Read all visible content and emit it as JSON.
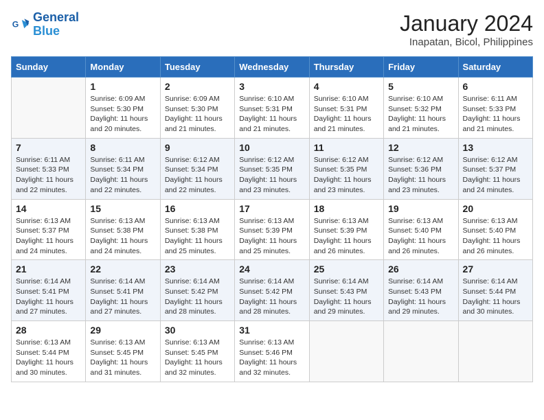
{
  "logo": {
    "line1": "General",
    "line2": "Blue"
  },
  "title": "January 2024",
  "subtitle": "Inapatan, Bicol, Philippines",
  "headers": [
    "Sunday",
    "Monday",
    "Tuesday",
    "Wednesday",
    "Thursday",
    "Friday",
    "Saturday"
  ],
  "weeks": [
    [
      {
        "num": "",
        "info": ""
      },
      {
        "num": "1",
        "info": "Sunrise: 6:09 AM\nSunset: 5:30 PM\nDaylight: 11 hours\nand 20 minutes."
      },
      {
        "num": "2",
        "info": "Sunrise: 6:09 AM\nSunset: 5:30 PM\nDaylight: 11 hours\nand 21 minutes."
      },
      {
        "num": "3",
        "info": "Sunrise: 6:10 AM\nSunset: 5:31 PM\nDaylight: 11 hours\nand 21 minutes."
      },
      {
        "num": "4",
        "info": "Sunrise: 6:10 AM\nSunset: 5:31 PM\nDaylight: 11 hours\nand 21 minutes."
      },
      {
        "num": "5",
        "info": "Sunrise: 6:10 AM\nSunset: 5:32 PM\nDaylight: 11 hours\nand 21 minutes."
      },
      {
        "num": "6",
        "info": "Sunrise: 6:11 AM\nSunset: 5:33 PM\nDaylight: 11 hours\nand 21 minutes."
      }
    ],
    [
      {
        "num": "7",
        "info": "Sunrise: 6:11 AM\nSunset: 5:33 PM\nDaylight: 11 hours\nand 22 minutes."
      },
      {
        "num": "8",
        "info": "Sunrise: 6:11 AM\nSunset: 5:34 PM\nDaylight: 11 hours\nand 22 minutes."
      },
      {
        "num": "9",
        "info": "Sunrise: 6:12 AM\nSunset: 5:34 PM\nDaylight: 11 hours\nand 22 minutes."
      },
      {
        "num": "10",
        "info": "Sunrise: 6:12 AM\nSunset: 5:35 PM\nDaylight: 11 hours\nand 23 minutes."
      },
      {
        "num": "11",
        "info": "Sunrise: 6:12 AM\nSunset: 5:35 PM\nDaylight: 11 hours\nand 23 minutes."
      },
      {
        "num": "12",
        "info": "Sunrise: 6:12 AM\nSunset: 5:36 PM\nDaylight: 11 hours\nand 23 minutes."
      },
      {
        "num": "13",
        "info": "Sunrise: 6:12 AM\nSunset: 5:37 PM\nDaylight: 11 hours\nand 24 minutes."
      }
    ],
    [
      {
        "num": "14",
        "info": "Sunrise: 6:13 AM\nSunset: 5:37 PM\nDaylight: 11 hours\nand 24 minutes."
      },
      {
        "num": "15",
        "info": "Sunrise: 6:13 AM\nSunset: 5:38 PM\nDaylight: 11 hours\nand 24 minutes."
      },
      {
        "num": "16",
        "info": "Sunrise: 6:13 AM\nSunset: 5:38 PM\nDaylight: 11 hours\nand 25 minutes."
      },
      {
        "num": "17",
        "info": "Sunrise: 6:13 AM\nSunset: 5:39 PM\nDaylight: 11 hours\nand 25 minutes."
      },
      {
        "num": "18",
        "info": "Sunrise: 6:13 AM\nSunset: 5:39 PM\nDaylight: 11 hours\nand 26 minutes."
      },
      {
        "num": "19",
        "info": "Sunrise: 6:13 AM\nSunset: 5:40 PM\nDaylight: 11 hours\nand 26 minutes."
      },
      {
        "num": "20",
        "info": "Sunrise: 6:13 AM\nSunset: 5:40 PM\nDaylight: 11 hours\nand 26 minutes."
      }
    ],
    [
      {
        "num": "21",
        "info": "Sunrise: 6:14 AM\nSunset: 5:41 PM\nDaylight: 11 hours\nand 27 minutes."
      },
      {
        "num": "22",
        "info": "Sunrise: 6:14 AM\nSunset: 5:41 PM\nDaylight: 11 hours\nand 27 minutes."
      },
      {
        "num": "23",
        "info": "Sunrise: 6:14 AM\nSunset: 5:42 PM\nDaylight: 11 hours\nand 28 minutes."
      },
      {
        "num": "24",
        "info": "Sunrise: 6:14 AM\nSunset: 5:42 PM\nDaylight: 11 hours\nand 28 minutes."
      },
      {
        "num": "25",
        "info": "Sunrise: 6:14 AM\nSunset: 5:43 PM\nDaylight: 11 hours\nand 29 minutes."
      },
      {
        "num": "26",
        "info": "Sunrise: 6:14 AM\nSunset: 5:43 PM\nDaylight: 11 hours\nand 29 minutes."
      },
      {
        "num": "27",
        "info": "Sunrise: 6:14 AM\nSunset: 5:44 PM\nDaylight: 11 hours\nand 30 minutes."
      }
    ],
    [
      {
        "num": "28",
        "info": "Sunrise: 6:13 AM\nSunset: 5:44 PM\nDaylight: 11 hours\nand 30 minutes."
      },
      {
        "num": "29",
        "info": "Sunrise: 6:13 AM\nSunset: 5:45 PM\nDaylight: 11 hours\nand 31 minutes."
      },
      {
        "num": "30",
        "info": "Sunrise: 6:13 AM\nSunset: 5:45 PM\nDaylight: 11 hours\nand 32 minutes."
      },
      {
        "num": "31",
        "info": "Sunrise: 6:13 AM\nSunset: 5:46 PM\nDaylight: 11 hours\nand 32 minutes."
      },
      {
        "num": "",
        "info": ""
      },
      {
        "num": "",
        "info": ""
      },
      {
        "num": "",
        "info": ""
      }
    ]
  ]
}
